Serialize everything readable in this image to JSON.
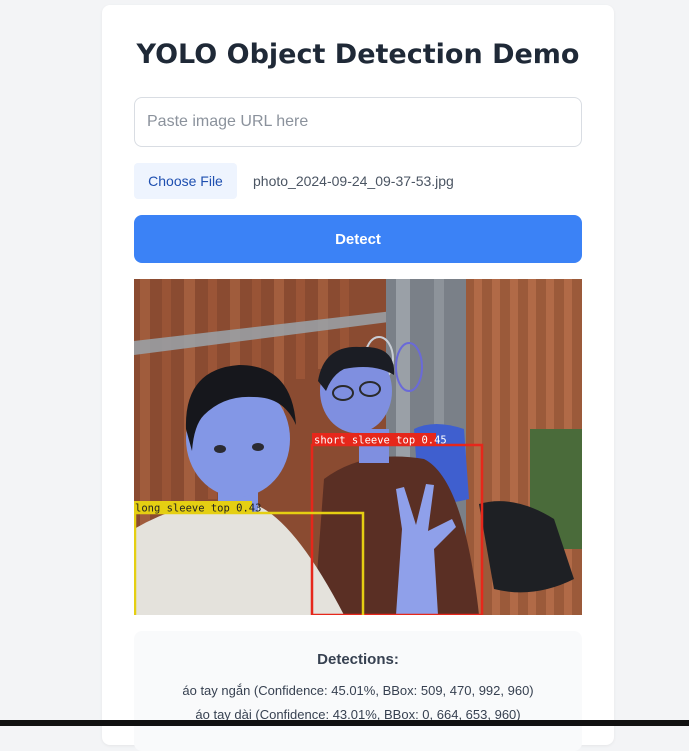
{
  "header": {
    "title": "YOLO Object Detection Demo"
  },
  "form": {
    "url_placeholder": "Paste image URL here",
    "url_value": "",
    "file_button_label": "Choose File",
    "file_name": "photo_2024-09-24_09-37-53.jpg",
    "detect_label": "Detect"
  },
  "result_image": {
    "boxes": [
      {
        "label": "short sleeve top 0.45",
        "color": "#e6271b"
      },
      {
        "label": "long sleeve top 0.43",
        "color": "#e5cf12"
      }
    ]
  },
  "detections": {
    "heading": "Detections:",
    "items": [
      "áo tay ngắn (Confidence: 45.01%, BBox: 509, 470, 992, 960)",
      "áo tay dài (Confidence: 43.01%, BBox: 0, 664, 653, 960)"
    ]
  },
  "colors": {
    "background": "#f3f4f6",
    "card": "#ffffff",
    "primary": "#3b82f6",
    "file_button_bg": "#eef4fe",
    "text_dark": "#1f2937"
  }
}
